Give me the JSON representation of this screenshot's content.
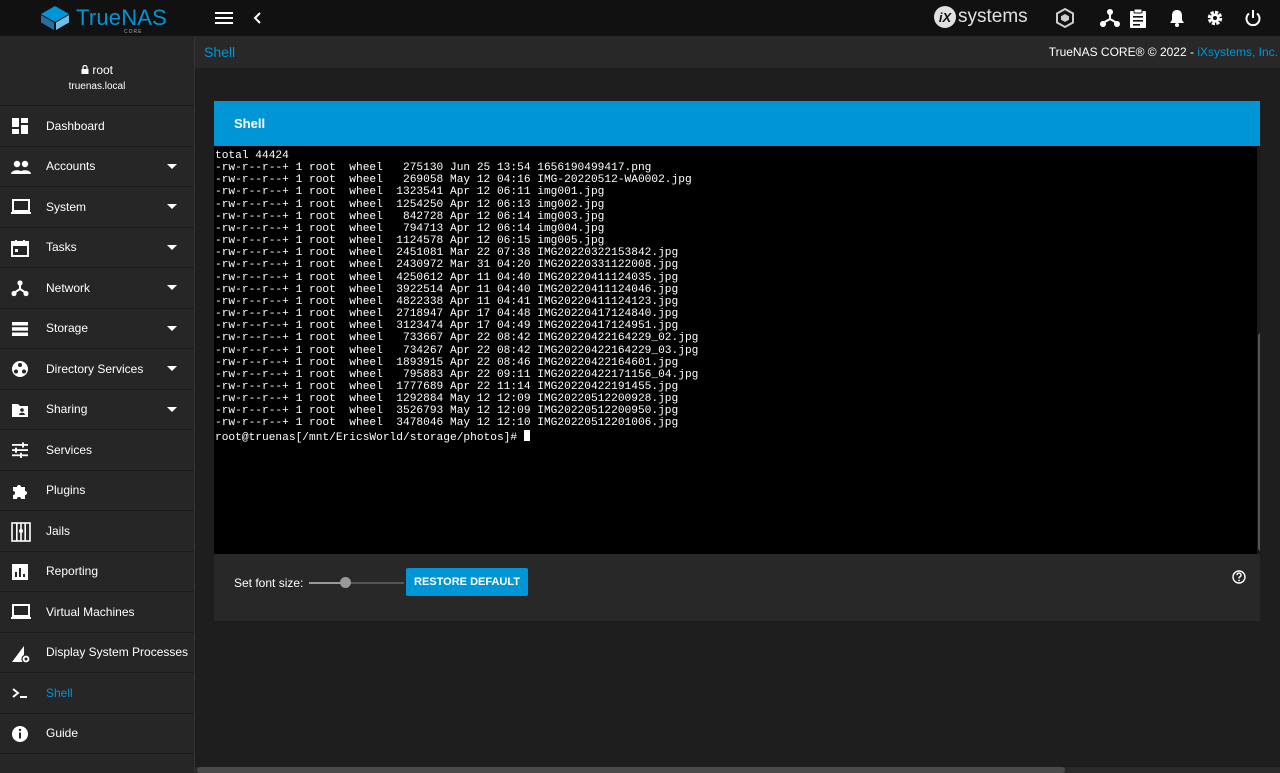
{
  "brand": {
    "name": "TrueNAS",
    "edition": "CORE",
    "vendor": "systems"
  },
  "breadcrumb": "Shell",
  "copyright": {
    "text": "TrueNAS CORE® © 2022 - ",
    "link": "iXsystems, Inc."
  },
  "user": {
    "name": "root",
    "host": "truenas.local"
  },
  "sidebar": {
    "items": [
      {
        "label": "Dashboard",
        "icon": "dashboard-icon",
        "expandable": false
      },
      {
        "label": "Accounts",
        "icon": "accounts-icon",
        "expandable": true
      },
      {
        "label": "System",
        "icon": "system-icon",
        "expandable": true
      },
      {
        "label": "Tasks",
        "icon": "tasks-icon",
        "expandable": true
      },
      {
        "label": "Network",
        "icon": "network-icon",
        "expandable": true
      },
      {
        "label": "Storage",
        "icon": "storage-icon",
        "expandable": true
      },
      {
        "label": "Directory Services",
        "icon": "directory-services-icon",
        "expandable": true
      },
      {
        "label": "Sharing",
        "icon": "sharing-icon",
        "expandable": true
      },
      {
        "label": "Services",
        "icon": "services-icon",
        "expandable": false
      },
      {
        "label": "Plugins",
        "icon": "plugins-icon",
        "expandable": false
      },
      {
        "label": "Jails",
        "icon": "jails-icon",
        "expandable": false
      },
      {
        "label": "Reporting",
        "icon": "reporting-icon",
        "expandable": false
      },
      {
        "label": "Virtual Machines",
        "icon": "virtual-machines-icon",
        "expandable": false
      },
      {
        "label": "Display System Processes",
        "icon": "processes-icon",
        "expandable": false
      },
      {
        "label": "Shell",
        "icon": "shell-icon",
        "expandable": false,
        "active": true
      },
      {
        "label": "Guide",
        "icon": "guide-icon",
        "expandable": false
      }
    ]
  },
  "shell": {
    "title": "Shell",
    "lines": [
      "total 44424",
      "-rw-r--r--+ 1 root  wheel   275130 Jun 25 13:54 1656190499417.png",
      "-rw-r--r--+ 1 root  wheel   269058 May 12 04:16 IMG-20220512-WA0002.jpg",
      "-rw-r--r--+ 1 root  wheel  1323541 Apr 12 06:11 img001.jpg",
      "-rw-r--r--+ 1 root  wheel  1254250 Apr 12 06:13 img002.jpg",
      "-rw-r--r--+ 1 root  wheel   842728 Apr 12 06:14 img003.jpg",
      "-rw-r--r--+ 1 root  wheel   794713 Apr 12 06:14 img004.jpg",
      "-rw-r--r--+ 1 root  wheel  1124578 Apr 12 06:15 img005.jpg",
      "-rw-r--r--+ 1 root  wheel  2451081 Mar 22 07:38 IMG20220322153842.jpg",
      "-rw-r--r--+ 1 root  wheel  2430972 Mar 31 04:20 IMG20220331122008.jpg",
      "-rw-r--r--+ 1 root  wheel  4250612 Apr 11 04:40 IMG20220411124035.jpg",
      "-rw-r--r--+ 1 root  wheel  3922514 Apr 11 04:40 IMG20220411124046.jpg",
      "-rw-r--r--+ 1 root  wheel  4822338 Apr 11 04:41 IMG20220411124123.jpg",
      "-rw-r--r--+ 1 root  wheel  2718947 Apr 17 04:48 IMG20220417124840.jpg",
      "-rw-r--r--+ 1 root  wheel  3123474 Apr 17 04:49 IMG20220417124951.jpg",
      "-rw-r--r--+ 1 root  wheel   733667 Apr 22 08:42 IMG20220422164229_02.jpg",
      "-rw-r--r--+ 1 root  wheel   734267 Apr 22 08:42 IMG20220422164229_03.jpg",
      "-rw-r--r--+ 1 root  wheel  1893915 Apr 22 08:46 IMG20220422164601.jpg",
      "-rw-r--r--+ 1 root  wheel   795883 Apr 22 09:11 IMG20220422171156_04.jpg",
      "-rw-r--r--+ 1 root  wheel  1777689 Apr 22 11:14 IMG20220422191455.jpg",
      "-rw-r--r--+ 1 root  wheel  1292884 May 12 12:09 IMG20220512200928.jpg",
      "-rw-r--r--+ 1 root  wheel  3526793 May 12 12:09 IMG20220512200950.jpg",
      "-rw-r--r--+ 1 root  wheel  3478046 May 12 12:10 IMG20220512201006.jpg"
    ],
    "prompt": "root@truenas[/mnt/EricsWorld/storage/photos]# ",
    "font_size_label": "Set font size:",
    "font_size_level": 0.38,
    "restore_label": "RESTORE DEFAULT"
  },
  "colors": {
    "accent": "#0095d5",
    "topbar": "#111111",
    "sidebar": "#262626",
    "terminal": "#000000"
  }
}
